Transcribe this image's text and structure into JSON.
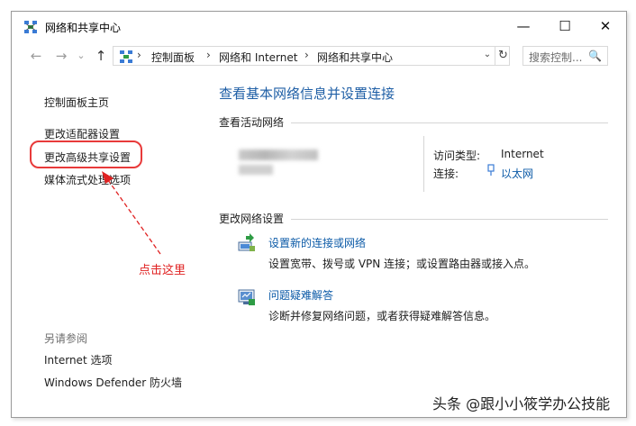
{
  "window": {
    "title": "网络和共享中心",
    "minimize_symbol": "—",
    "maximize_symbol": "☐",
    "close_symbol": "✕"
  },
  "address_bar": {
    "back_symbol": "←",
    "forward_symbol": "→",
    "history_symbol": "⌄",
    "up_symbol": "↑",
    "breadcrumb": [
      "控制面板",
      "网络和 Internet",
      "网络和共享中心"
    ],
    "separator": "›",
    "dropdown_symbol": "⌄",
    "refresh_symbol": "↻",
    "search_placeholder": "搜索控制...",
    "search_icon": "🔍"
  },
  "sidebar": {
    "home": "控制面板主页",
    "items": [
      "更改适配器设置",
      "更改高级共享设置",
      "媒体流式处理选项"
    ],
    "see_also_title": "另请参阅",
    "see_also_items": [
      "Internet 选项",
      "Windows Defender 防火墙"
    ]
  },
  "main": {
    "title": "查看基本网络信息并设置连接",
    "active_section": "查看活动网络",
    "access_type_label": "访问类型:",
    "access_type_value": "Internet",
    "connection_label": "连接:",
    "connection_value": "以太网",
    "change_section": "更改网络设置",
    "tasks": [
      {
        "link": "设置新的连接或网络",
        "desc": "设置宽带、拨号或 VPN 连接；或设置路由器或接入点。"
      },
      {
        "link": "问题疑难解答",
        "desc": "诊断并修复网络问题，或者获得疑难解答信息。"
      }
    ]
  },
  "annotation": {
    "text": "点击这里",
    "color": "#e02222"
  },
  "watermark": "头条 @跟小小筱学办公技能",
  "colors": {
    "link": "#0b5aa7",
    "title": "#1f5fa6",
    "highlight": "#e83a3a"
  }
}
